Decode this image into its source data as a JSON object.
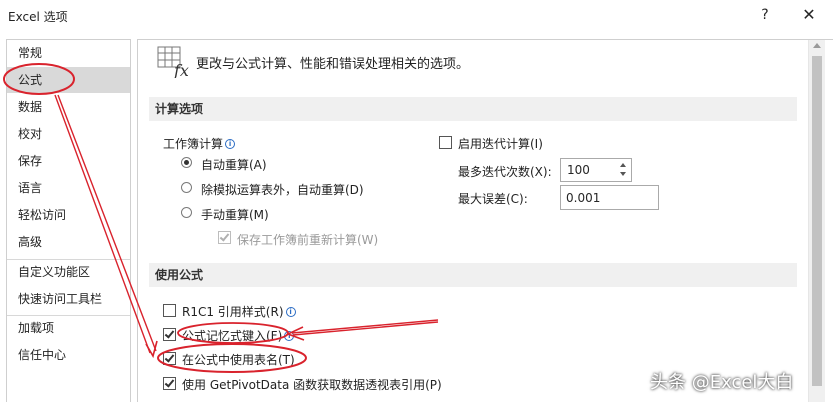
{
  "window": {
    "title": "Excel 选项",
    "help": "?",
    "close": "✕"
  },
  "sidebar": {
    "items": [
      {
        "label": "常规"
      },
      {
        "label": "公式"
      },
      {
        "label": "数据"
      },
      {
        "label": "校对"
      },
      {
        "label": "保存"
      },
      {
        "label": "语言"
      },
      {
        "label": "轻松访问"
      },
      {
        "label": "高级"
      },
      {
        "label": "自定义功能区"
      },
      {
        "label": "快速访问工具栏"
      },
      {
        "label": "加载项"
      },
      {
        "label": "信任中心"
      }
    ],
    "selected": "公式"
  },
  "main": {
    "header": "更改与公式计算、性能和错误处理相关的选项。",
    "header_icon": "fx-formula-icon",
    "calc": {
      "section_title": "计算选项",
      "workbook_calc_label": "工作簿计算",
      "radios": [
        {
          "label": "自动重算(A)",
          "checked": true
        },
        {
          "label": "除模拟运算表外，自动重算(D)",
          "checked": false
        },
        {
          "label": "手动重算(M)",
          "checked": false
        }
      ],
      "recalc_before_save": {
        "label": "保存工作簿前重新计算(W)",
        "checked": true,
        "disabled": true
      },
      "iterative": {
        "label": "启用迭代计算(I)",
        "checked": false
      },
      "max_iterations_label": "最多迭代次数(X):",
      "max_iterations_value": "100",
      "max_change_label": "最大误差(C):",
      "max_change_value": "0.001"
    },
    "formulas": {
      "section_title": "使用公式",
      "options": [
        {
          "label": "R1C1 引用样式(R)",
          "checked": false,
          "info": true
        },
        {
          "label": "公式记忆式键入(F)",
          "checked": true,
          "info": true
        },
        {
          "label": "在公式中使用表名(T)",
          "checked": true,
          "info": false
        },
        {
          "label": "使用 GetPivotData 函数获取数据透视表引用(P)",
          "checked": true,
          "info": false
        }
      ]
    }
  },
  "watermark": "头条 @Excel大白",
  "colors": {
    "annotation_red": "#d9232d",
    "selected_bg": "#d9d9d9",
    "section_bg": "#f0f0f0"
  }
}
